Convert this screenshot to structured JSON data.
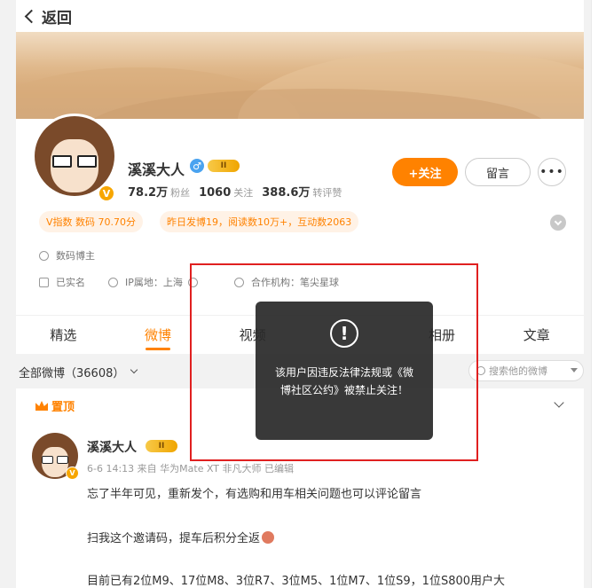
{
  "header": {
    "back_label": "返回"
  },
  "profile": {
    "name": "溪溪大人",
    "vip_level": "II",
    "verified_badge": "V",
    "stats": [
      {
        "num": "78.2万",
        "label": "粉丝"
      },
      {
        "num": "1060",
        "label": "关注"
      },
      {
        "num": "388.6万",
        "label": "转评赞"
      }
    ],
    "follow_label": "+关注",
    "message_label": "留言",
    "more_label": "•••",
    "tags": [
      "V指数 数码 70.70分",
      "昨日发博19，阅读数10万+，互动数2063"
    ],
    "info": {
      "category": "数码博主",
      "real_name": "已实名",
      "ip_label": "IP属地：上海",
      "agency_label": "合作机构：笔尖星球"
    }
  },
  "tabs": [
    "精选",
    "微博",
    "视频",
    "",
    "相册",
    "文章"
  ],
  "filter": {
    "label": "全部微博（36608）",
    "search_placeholder": "搜索他的微博"
  },
  "post": {
    "pin_label": "置顶",
    "author": "溪溪大人",
    "vip_level": "II",
    "meta": "6-6 14:13 来自 华为Mate XT 非凡大师 已编辑",
    "lines": [
      "忘了半年可见，重新发个，有选购和用车相关问题也可以评论留言",
      "扫我这个邀请码，提车后积分全返",
      "目前已有2位M9、17位M8、3位R7、3位M5、1位M7、1位S9，1位S800用户大"
    ]
  },
  "toast": {
    "icon": "!",
    "message": "该用户因违反法律法规或《微博社区公约》被禁止关注！"
  },
  "colors": {
    "accent": "#ff8200",
    "highlight_box": "#e02020"
  }
}
